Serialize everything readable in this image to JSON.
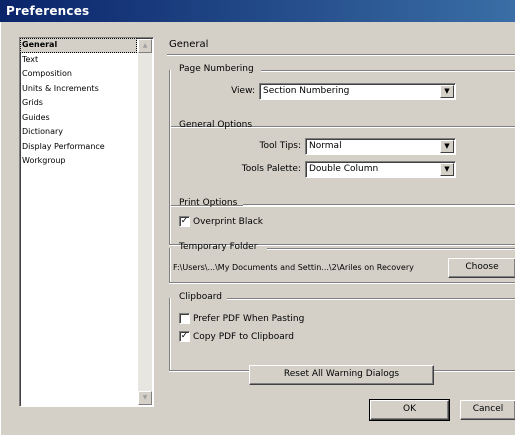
{
  "window": {
    "title": "Preferences"
  },
  "sidebar": {
    "items": [
      {
        "label": "General"
      },
      {
        "label": "Text"
      },
      {
        "label": "Composition"
      },
      {
        "label": "Units & Increments"
      },
      {
        "label": "Grids"
      },
      {
        "label": "Guides"
      },
      {
        "label": "Dictionary"
      },
      {
        "label": "Display Performance"
      },
      {
        "label": "Workgroup"
      }
    ],
    "selected": "General"
  },
  "panel": {
    "title": "General"
  },
  "page_numbering": {
    "label": "Page Numbering",
    "view_label": "View:",
    "view_value": "Section Numbering"
  },
  "general_options": {
    "label": "General Options",
    "tool_tips_label": "Tool Tips:",
    "tool_tips_value": "Normal",
    "toolbox_label": "Tools Palette:",
    "toolbox_value": "Double Column"
  },
  "print_options": {
    "label": "Print Options",
    "overprint_label": "Overprint Black",
    "overprint_checked": true
  },
  "temp_folder": {
    "label": "Temporary Folder",
    "path": "F:\\Users\\...\\My Documents and Settin...\\2\\Ariles on Recovery",
    "choose_label": "Choose"
  },
  "clipboard": {
    "label": "Clipboard",
    "prefer_pdf_label": "Prefer PDF When Pasting",
    "prefer_pdf_checked": false,
    "copy_pdf_label": "Copy PDF to Clipboard",
    "copy_pdf_checked": true
  },
  "buttons": {
    "reset_label": "Reset All Warning Dialogs",
    "ok_label": "OK",
    "cancel_label": "Cancel"
  }
}
